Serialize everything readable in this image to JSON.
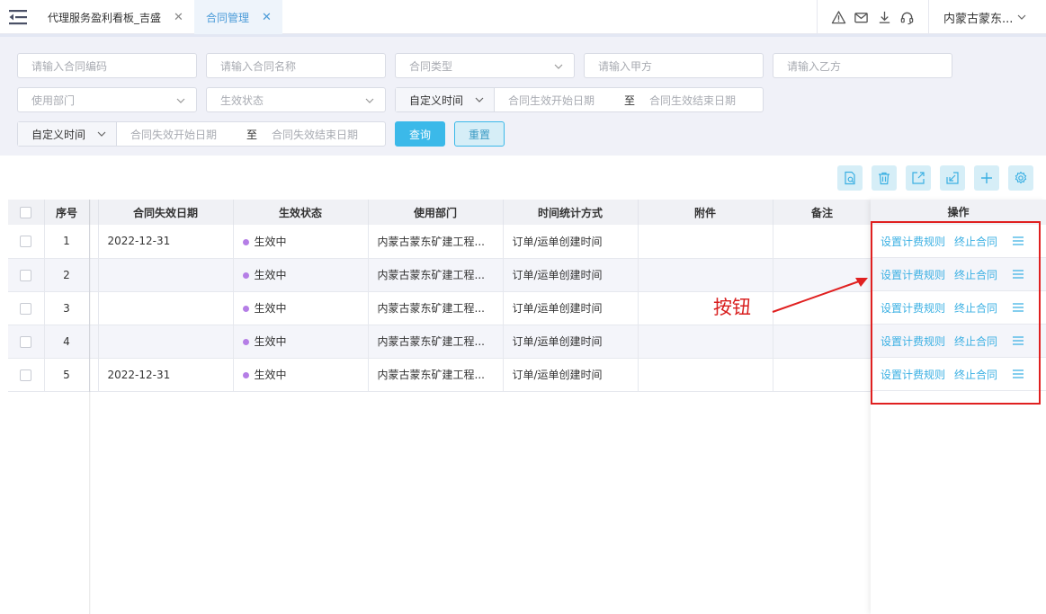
{
  "topbar": {
    "tabs": [
      {
        "label": "代理服务盈利看板_吉盛"
      },
      {
        "label": "合同管理"
      }
    ],
    "org_select": "内蒙古蒙东..."
  },
  "filters": {
    "contract_code_placeholder": "请输入合同编码",
    "contract_name_placeholder": "请输入合同名称",
    "contract_type_placeholder": "合同类型",
    "party_a_placeholder": "请输入甲方",
    "party_b_placeholder": "请输入乙方",
    "department_placeholder": "使用部门",
    "status_placeholder": "生效状态",
    "time_mode_1": "自定义时间",
    "effective_start_placeholder": "合同生效开始日期",
    "effective_end_placeholder": "合同生效结束日期",
    "time_mode_2": "自定义时间",
    "expire_start_placeholder": "合同失效开始日期",
    "expire_end_placeholder": "合同失效结束日期",
    "range_sep": "至",
    "query_label": "查询",
    "reset_label": "重置"
  },
  "table": {
    "columns": [
      "序号",
      "合同失效日期",
      "生效状态",
      "使用部门",
      "时间统计方式",
      "附件",
      "备注",
      "操作"
    ],
    "rows": [
      {
        "no": "1",
        "expire": "2022-12-31",
        "status": "生效中",
        "dept": "内蒙古蒙东矿建工程...",
        "time_mode": "订单/运单创建时间",
        "attach": "",
        "remark": ""
      },
      {
        "no": "2",
        "expire": "",
        "status": "生效中",
        "dept": "内蒙古蒙东矿建工程...",
        "time_mode": "订单/运单创建时间",
        "attach": "",
        "remark": ""
      },
      {
        "no": "3",
        "expire": "",
        "status": "生效中",
        "dept": "内蒙古蒙东矿建工程...",
        "time_mode": "订单/运单创建时间",
        "attach": "",
        "remark": ""
      },
      {
        "no": "4",
        "expire": "",
        "status": "生效中",
        "dept": "内蒙古蒙东矿建工程...",
        "time_mode": "订单/运单创建时间",
        "attach": "",
        "remark": ""
      },
      {
        "no": "5",
        "expire": "2022-12-31",
        "status": "生效中",
        "dept": "内蒙古蒙东矿建工程...",
        "time_mode": "订单/运单创建时间",
        "attach": "",
        "remark": ""
      }
    ],
    "row_actions": {
      "set_billing": "设置计费规则",
      "terminate": "终止合同"
    }
  },
  "annotation": {
    "label": "按钮"
  },
  "colors": {
    "accent": "#3bb9e9",
    "link": "#3bb0e3",
    "status_dot": "#b57ee6",
    "annotation_red": "#e02020"
  },
  "icons": {
    "menu_toggle": "menu-fold-icon",
    "top_icons": [
      "warning-icon",
      "mail-icon",
      "download-icon",
      "headset-icon"
    ],
    "toolbar": [
      "document-search-icon",
      "trash-icon",
      "export-icon",
      "import-icon",
      "plus-icon",
      "gear-icon"
    ],
    "row_more": "hamburger-menu-icon"
  }
}
